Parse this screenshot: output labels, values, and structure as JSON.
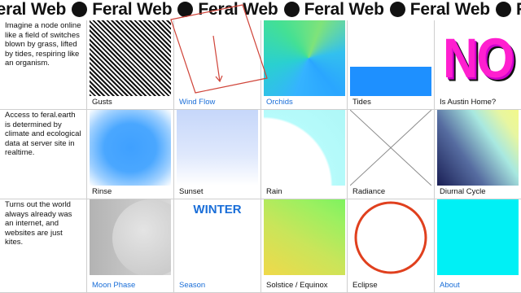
{
  "marquee": {
    "text": "Feral Web",
    "repeat": 7
  },
  "rows": [
    {
      "description": "Imagine a node online like a field of switches blown by grass, lifted by tides, respiring like an organism."
    },
    {
      "description": "Access to feral.earth is determined by climate and ecological data at server site in realtime."
    },
    {
      "description": "Turns out the world always already was an internet, and websites are just kites."
    }
  ],
  "tiles": {
    "gusts": "Gusts",
    "wind_flow": "Wind Flow",
    "orchids": "Orchids",
    "tides": "Tides",
    "austin": "Is Austin Home?",
    "austin_art": "NO",
    "rinse": "Rinse",
    "sunset": "Sunset",
    "rain": "Rain",
    "radiance": "Radiance",
    "diurnal": "Diurnal Cycle",
    "moon": "Moon Phase",
    "season": "Season",
    "season_art": "WINTER",
    "solstice": "Solstice / Equinox",
    "eclipse": "Eclipse",
    "about": "About"
  },
  "colors": {
    "link": "#1a6ed8",
    "tides_bar": "#1e90ff",
    "about": "#00f0f5",
    "eclipse_ring": "#e0401e",
    "austin_text": "#ff1fcf",
    "wind_flow_lines": "#d0453a"
  }
}
